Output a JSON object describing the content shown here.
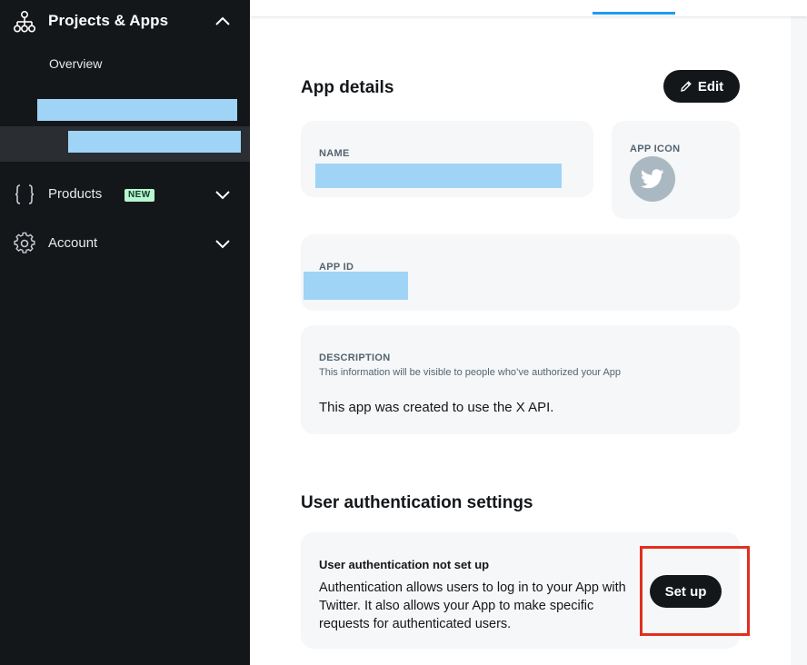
{
  "sidebar": {
    "header_label": "Projects & Apps",
    "overview_label": "Overview",
    "items": [
      {
        "label": "Products",
        "badge": "NEW"
      },
      {
        "label": "Account"
      }
    ]
  },
  "main": {
    "app_details": {
      "title": "App details",
      "edit_label": "Edit",
      "name_label": "NAME",
      "app_icon_label": "APP ICON",
      "app_id_label": "APP ID",
      "description_label": "DESCRIPTION",
      "description_help": "This information will be visible to people who’ve authorized your App",
      "description_value": "This app was created to use the X API."
    },
    "user_auth": {
      "title": "User authentication settings",
      "status_title": "User authentication not set up",
      "status_text": "Authentication allows users to log in to your App with Twitter. It also allows your App to make specific requests for authenticated users.",
      "setup_label": "Set up"
    }
  },
  "colors": {
    "sidebar_bg": "#14171a",
    "accent": "#1d9bf0",
    "redaction": "#9fd4f7",
    "badge_bg": "#b8f5d0",
    "highlight": "#e0301e"
  },
  "icons": [
    "sitemap-icon",
    "chevron-up-icon",
    "braces-icon",
    "gear-icon",
    "chevron-down-icon",
    "pencil-icon",
    "twitter-bird-icon"
  ]
}
